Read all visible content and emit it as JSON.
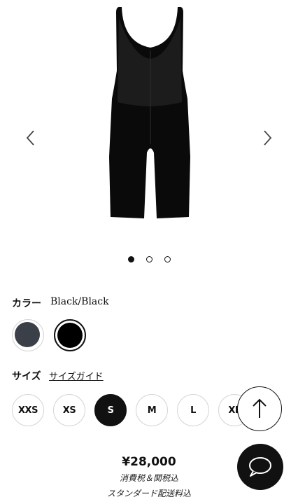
{
  "gallery": {
    "prev_icon": "chevron-left-icon",
    "next_icon": "chevron-right-icon",
    "slide_count": 3,
    "active_slide": 1
  },
  "color": {
    "label": "カラー",
    "value": "Black/Black",
    "swatches": [
      {
        "name": "grey",
        "color": "#3a3f48",
        "selected": false
      },
      {
        "name": "black",
        "color": "#000000",
        "selected": true
      }
    ]
  },
  "size": {
    "label": "サイズ",
    "guide_link": "サイズガイド",
    "options": [
      "XXS",
      "XS",
      "S",
      "M",
      "L",
      "XL"
    ],
    "selected": "S"
  },
  "price": {
    "amount": "¥28,000",
    "tax_note": "消費税＆関税込",
    "shipping_note": "スタンダード配送料込"
  },
  "floating": {
    "scroll_top_icon": "arrow-up-icon",
    "chat_icon": "chat-bubble-icon"
  }
}
